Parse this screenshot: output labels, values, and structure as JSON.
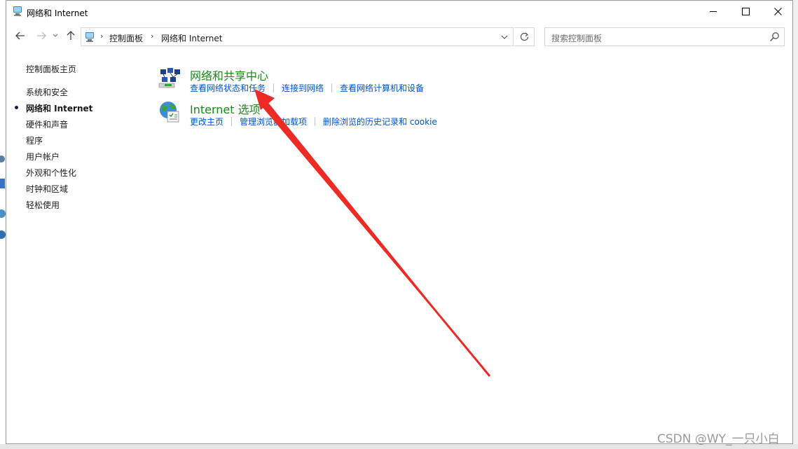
{
  "window": {
    "title": "网络和 Internet"
  },
  "address": {
    "crumbs": [
      "控制面板",
      "网络和 Internet"
    ],
    "separator": "›"
  },
  "search": {
    "placeholder": "搜索控制面板"
  },
  "sidebar": {
    "home": "控制面板主页",
    "items": [
      {
        "label": "系统和安全",
        "current": false
      },
      {
        "label": "网络和 Internet",
        "current": true
      },
      {
        "label": "硬件和声音",
        "current": false
      },
      {
        "label": "程序",
        "current": false
      },
      {
        "label": "用户帐户",
        "current": false
      },
      {
        "label": "外观和个性化",
        "current": false
      },
      {
        "label": "时钟和区域",
        "current": false
      },
      {
        "label": "轻松使用",
        "current": false
      }
    ]
  },
  "main": {
    "categories": [
      {
        "title": "网络和共享中心",
        "icon": "network-sharing-center-icon",
        "links": [
          "查看网络状态和任务",
          "连接到网络",
          "查看网络计算机和设备"
        ]
      },
      {
        "title": "Internet 选项",
        "icon": "internet-options-icon",
        "links": [
          "更改主页",
          "管理浏览器加载项",
          "删除浏览的历史记录和 cookie"
        ]
      }
    ]
  },
  "watermark": "CSDN @WY_一只小白",
  "colors": {
    "category_title": "#1a8a1a",
    "link": "#0055cc",
    "annotation_arrow": "#ee2a24"
  }
}
